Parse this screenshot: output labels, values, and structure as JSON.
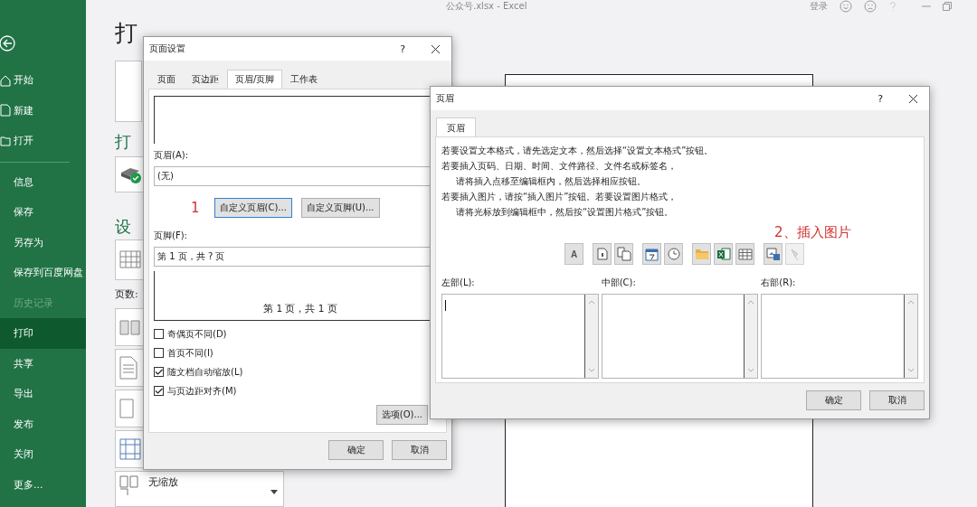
{
  "app_title": "公众号.xlsx  -  Excel",
  "title_bar": {
    "sign_in": "登录"
  },
  "sidebar": {
    "top_items": [
      {
        "label": "开始",
        "kind": "home"
      },
      {
        "label": "新建",
        "kind": "new"
      },
      {
        "label": "打开",
        "kind": "open"
      }
    ],
    "items": [
      {
        "label": "信息",
        "selected": false,
        "disabled": false
      },
      {
        "label": "保存",
        "selected": false,
        "disabled": false
      },
      {
        "label": "另存为",
        "selected": false,
        "disabled": false
      },
      {
        "label": "保存到百度网盘",
        "selected": false,
        "disabled": false
      },
      {
        "label": "历史记录",
        "selected": false,
        "disabled": true
      },
      {
        "label": "打印",
        "selected": true,
        "disabled": false
      },
      {
        "label": "共享",
        "selected": false,
        "disabled": false
      },
      {
        "label": "导出",
        "selected": false,
        "disabled": false
      },
      {
        "label": "发布",
        "selected": false,
        "disabled": false
      },
      {
        "label": "关闭",
        "selected": false,
        "disabled": false
      },
      {
        "label": "更多...",
        "selected": false,
        "disabled": false
      }
    ]
  },
  "backstage": {
    "title": "打",
    "printer_heading": "打",
    "settings_heading": "设",
    "pages_label": "页数:",
    "scaling": "无缩放"
  },
  "page_setup": {
    "title": "页面设置",
    "help": "?",
    "tabs": [
      {
        "label": "页面",
        "selected": false
      },
      {
        "label": "页边距",
        "selected": false
      },
      {
        "label": "页眉/页脚",
        "selected": true
      },
      {
        "label": "工作表",
        "selected": false
      }
    ],
    "header_label": "页眉(A):",
    "header_value": "(无)",
    "step_mark": "1",
    "custom_header_button": "自定义页眉(C)...",
    "custom_footer_button": "自定义页脚(U)...",
    "footer_label": "页脚(F):",
    "footer_value": "第 1 页，共 ? 页",
    "footer_preview": "第 1 页，共 1 页",
    "checkboxes": [
      {
        "label": "奇偶页不同(D)",
        "checked": false
      },
      {
        "label": "首页不同(I)",
        "checked": false
      },
      {
        "label": "随文档自动缩放(L)",
        "checked": true
      },
      {
        "label": "与页边距对齐(M)",
        "checked": true
      }
    ],
    "options_button": "选项(O)...",
    "ok": "确定",
    "cancel": "取消"
  },
  "header_dialog": {
    "title": "页眉",
    "help": "?",
    "tabs": [
      {
        "label": "页眉",
        "selected": true
      }
    ],
    "instructions": [
      {
        "text": "若要设置文本格式，请先选定文本，然后选择“设置文本格式”按钮。",
        "indent": false
      },
      {
        "text": "若要插入页码、日期、时间、文件路径、文件名或标签名，",
        "indent": false
      },
      {
        "text": "请将插入点移至编辑框内，然后选择相应按钮。",
        "indent": true
      },
      {
        "text": "若要插入图片，请按“插入图片”按钮。若要设置图片格式，",
        "indent": false
      },
      {
        "text": "请将光标放到编辑框中，然后按“设置图片格式”按钮。",
        "indent": true
      }
    ],
    "annotation": "2、插入图片",
    "toolbar_groups": [
      {
        "buttons": [
          {
            "kind": "text",
            "label": "A",
            "disabled": false
          }
        ]
      },
      {
        "buttons": [
          {
            "kind": "page_number",
            "disabled": false
          },
          {
            "kind": "page_count",
            "disabled": false
          }
        ]
      },
      {
        "buttons": [
          {
            "kind": "date",
            "disabled": false
          },
          {
            "kind": "time",
            "disabled": false
          }
        ]
      },
      {
        "buttons": [
          {
            "kind": "file_path",
            "disabled": false
          },
          {
            "kind": "file_name",
            "disabled": false
          },
          {
            "kind": "sheet_name",
            "disabled": false
          }
        ]
      },
      {
        "buttons": [
          {
            "kind": "picture",
            "disabled": false
          },
          {
            "kind": "format_picture",
            "disabled": true
          }
        ]
      }
    ],
    "sections": [
      {
        "label": "左部(L):",
        "focused": true
      },
      {
        "label": "中部(C):",
        "focused": false
      },
      {
        "label": "右部(R):",
        "focused": false
      }
    ],
    "ok": "确定",
    "cancel": "取消"
  }
}
